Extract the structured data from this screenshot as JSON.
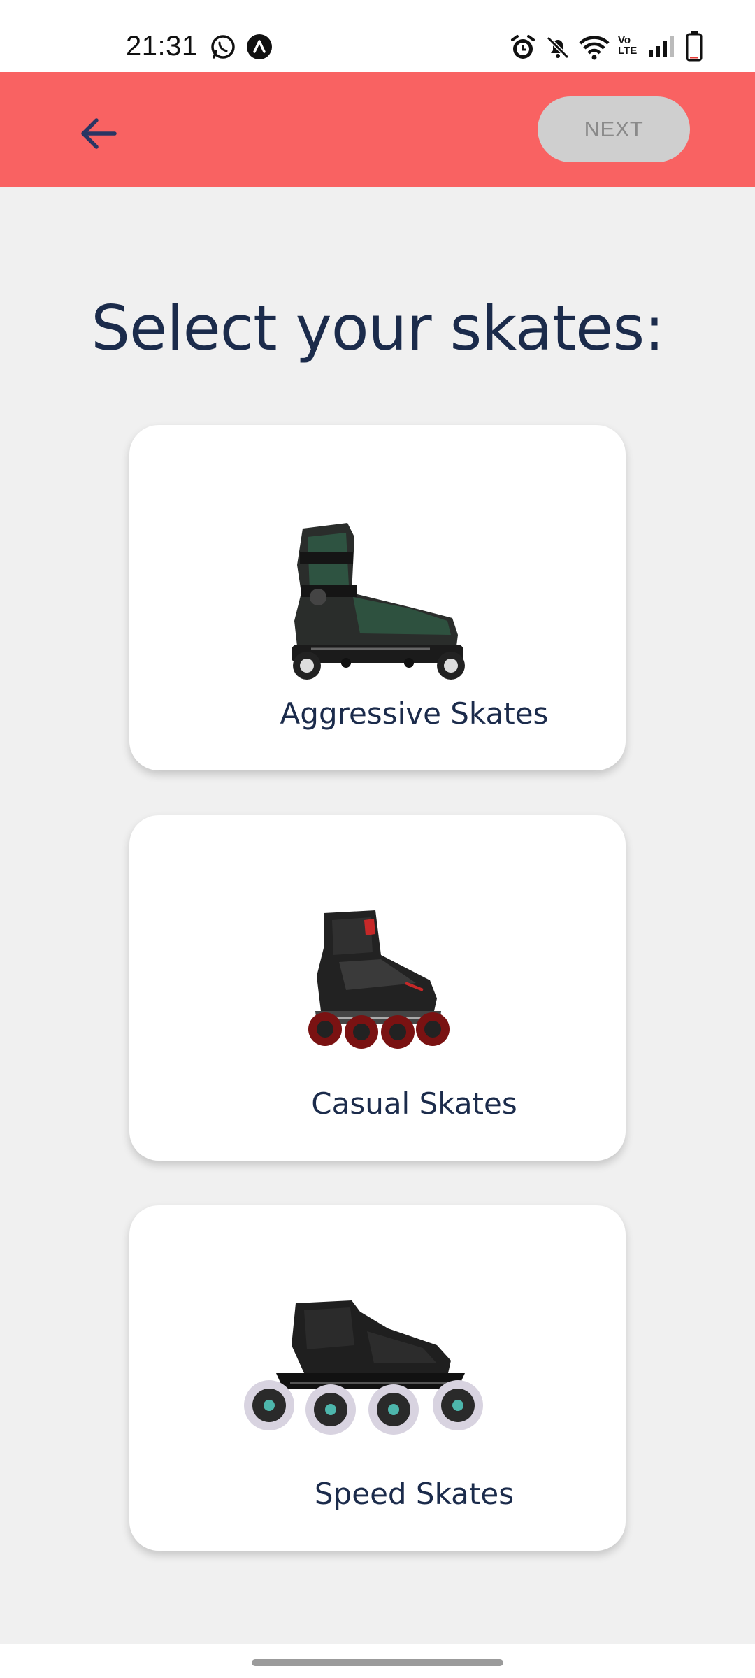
{
  "status_bar": {
    "time": "21:31",
    "left_icons": [
      "whatsapp-icon",
      "app-notification-icon"
    ],
    "right_icons": [
      "alarm-icon",
      "muted-bell-icon",
      "wifi-icon",
      "volte-icon",
      "signal-icon",
      "battery-icon"
    ],
    "volte_text": "Vo LTE"
  },
  "app_bar": {
    "back_icon": "arrow-left-icon",
    "next_label": "NEXT",
    "background_color": "#f96262",
    "next_button_color": "#cfcfcf"
  },
  "main": {
    "title": "Select your skates:",
    "options": [
      {
        "label": "Aggressive Skates",
        "image": "aggressive-skate-image"
      },
      {
        "label": "Casual Skates",
        "image": "casual-skate-image"
      },
      {
        "label": "Speed Skates",
        "image": "speed-skate-image"
      }
    ]
  },
  "colors": {
    "title_text": "#1b2b4b",
    "page_background": "#f0f0f0"
  }
}
